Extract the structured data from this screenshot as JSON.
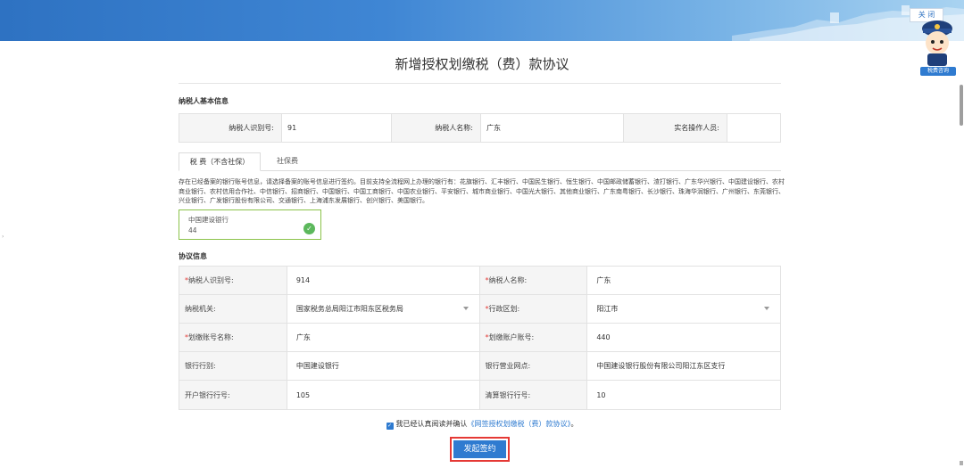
{
  "header": {
    "close_label": "关 闭",
    "mascot_label": "税费咨询"
  },
  "page": {
    "title": "新增授权划缴税（费）款协议"
  },
  "basic_info": {
    "section_title": "纳税人基本信息",
    "taxpayer_id_label": "纳税人识别号:",
    "taxpayer_id_value": "91",
    "taxpayer_name_label": "纳税人名称:",
    "taxpayer_name_value": "广东",
    "operator_label": "实名操作人员:",
    "operator_value": ""
  },
  "tabs": [
    {
      "label": "税 费（不含社保）",
      "active": true
    },
    {
      "label": "社保费",
      "active": false
    }
  ],
  "notice": "存在已经备案的银行账号信息，请选择备案的账号信息进行签约。目前支持全流程网上办理的银行有：花旗银行、汇丰银行、中国民生银行、恒生银行、中国邮政储蓄银行、渣打银行、广东华兴银行、中国建设银行、农村商业银行、农村信用合作社、中信银行、招商银行、中国银行、中国工商银行、中国农业银行、平安银行、城市商业银行、中国光大银行、其他商业银行、广东南粤银行、长沙银行、珠海华润银行、广州银行、东莞银行、兴业银行、广发银行股份有限公司、交通银行、上海浦东发展银行、创兴银行、美国银行。",
  "bank_card": {
    "bank_name": "中国建设银行",
    "account": "44"
  },
  "agreement": {
    "section_title": "协议信息",
    "rows": [
      {
        "l1": "纳税人识别号:",
        "r1": true,
        "v1": "914",
        "l2": "纳税人名称:",
        "r2": true,
        "v2": "广东"
      },
      {
        "l1": "纳税机关:",
        "r1": false,
        "v1": "国家税务总局阳江市阳东区税务局",
        "l2": "行政区划:",
        "r2": true,
        "v2": "阳江市"
      },
      {
        "l1": "划缴账号名称:",
        "r1": true,
        "v1": "广东",
        "l2": "划缴账户账号:",
        "r2": true,
        "v2": "440"
      },
      {
        "l1": "银行行别:",
        "r1": false,
        "v1": "中国建设银行",
        "l2": "银行营业网点:",
        "r2": false,
        "v2": "中国建设银行股份有限公司阳江东区支行"
      },
      {
        "l1": "开户银行行号:",
        "r1": false,
        "v1": "105",
        "l2": "清算银行行号:",
        "r2": false,
        "v2": "10"
      }
    ]
  },
  "agree": {
    "prefix": "我已经认真阅读并确认",
    "link": "《网签授权划缴税（费）款协议》",
    "suffix": "。"
  },
  "submit_label": "发起签约",
  "colors": {
    "primary": "#2f7bd0",
    "highlight": "#e53935",
    "success": "#5cb85c"
  }
}
